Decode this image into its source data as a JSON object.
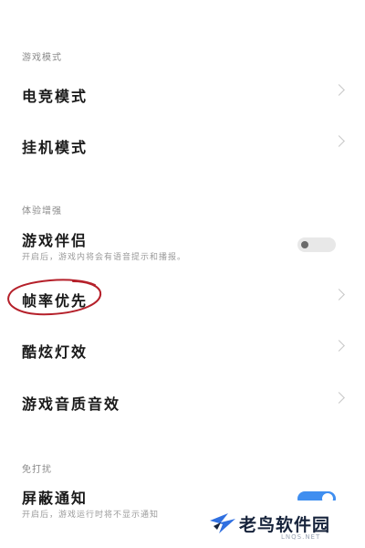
{
  "sections": {
    "scene_mode": "游戏模式",
    "experience": "体验增强",
    "do_not_disturb": "免打扰"
  },
  "rows": {
    "movie_mode": {
      "title": "电竞模式"
    },
    "hangup_mode": {
      "title": "挂机模式"
    },
    "game_voice": {
      "title": "游戏伴侣",
      "desc": "开启后，游戏内将会有语音提示和播报。",
      "toggle": false
    },
    "frame_priority": {
      "title": "帧率优先"
    },
    "breathing_light": {
      "title": "酷炫灯效"
    },
    "game_sound": {
      "title": "游戏音质音效"
    },
    "block_notice": {
      "title": "屏蔽通知",
      "desc": "开启后，游戏运行时将不显示通知",
      "toggle": true
    },
    "partial": {
      "title": ""
    }
  },
  "watermark": {
    "text": "老鸟软件园",
    "sub": "LNQS.NET"
  },
  "colors": {
    "accent": "#3f8ef0",
    "annotation": "#b5202a"
  }
}
